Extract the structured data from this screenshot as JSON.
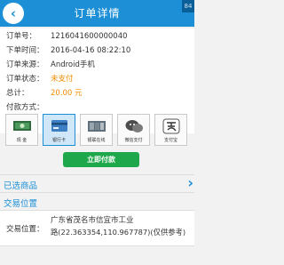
{
  "header": {
    "title": "订单详情",
    "status_text": "84"
  },
  "order": {
    "rows": [
      {
        "label": "订单号：",
        "value": "1216041600000040"
      },
      {
        "label": "下单时间：",
        "value": "2016-04-16 08:22:10"
      },
      {
        "label": "订单来源：",
        "value": "Android手机"
      },
      {
        "label": "订单状态：",
        "value": "未支付"
      },
      {
        "label": "总计：",
        "value": "20.00 元"
      },
      {
        "label": "付款方式：",
        "value": ""
      }
    ]
  },
  "payment": {
    "methods": [
      {
        "label": "现 金",
        "icon": "cash-icon"
      },
      {
        "label": "银行卡",
        "icon": "bank-card-icon"
      },
      {
        "label": "银联在线",
        "icon": "unionpay-icon"
      },
      {
        "label": "微信支付",
        "icon": "wechat-pay-icon"
      },
      {
        "label": "支付宝",
        "icon": "alipay-icon"
      }
    ],
    "selected_index": 1,
    "pay_button": "立即付款"
  },
  "sections": {
    "selected_goods": "已选商品",
    "delivery_location": "交易位置"
  },
  "address": {
    "label": "交易位置：",
    "line1": "广东省茂名市信宜市工业",
    "line2": "路(22.363354,110.967787)(仅供参考)"
  },
  "colors": {
    "brand": "#1c8fd6",
    "accent": "#f08b00",
    "pay_button": "#1ea84b"
  }
}
